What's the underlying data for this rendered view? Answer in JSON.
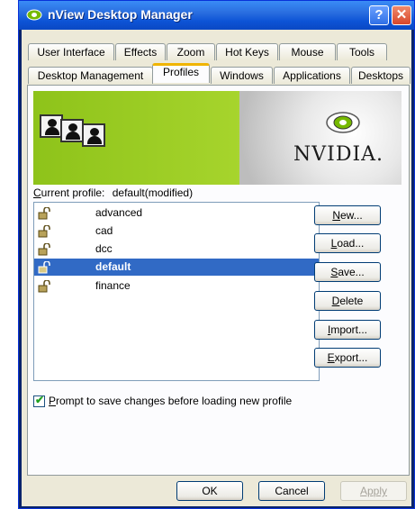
{
  "window": {
    "title": "nView Desktop Manager",
    "help_glyph": "?",
    "close_glyph": "✕"
  },
  "tabs": {
    "row1": [
      "User Interface",
      "Effects",
      "Zoom",
      "Hot Keys",
      "Mouse",
      "Tools"
    ],
    "row2": [
      "Desktop Management",
      "Profiles",
      "Windows",
      "Applications",
      "Desktops"
    ],
    "active": "Profiles"
  },
  "banner": {
    "brand_text": "NVIDIA."
  },
  "current_profile": {
    "label_prefix": "C",
    "label_rest": "urrent profile:",
    "value": "default(modified)"
  },
  "profiles": [
    {
      "name": "advanced",
      "selected": false
    },
    {
      "name": "cad",
      "selected": false
    },
    {
      "name": "dcc",
      "selected": false
    },
    {
      "name": "default",
      "selected": true
    },
    {
      "name": "finance",
      "selected": false
    }
  ],
  "actions": [
    {
      "pre": "",
      "key": "N",
      "post": "ew..."
    },
    {
      "pre": "",
      "key": "L",
      "post": "oad..."
    },
    {
      "pre": "",
      "key": "S",
      "post": "ave..."
    },
    {
      "pre": "",
      "key": "D",
      "post": "elete"
    },
    {
      "pre": "",
      "key": "I",
      "post": "mport..."
    },
    {
      "pre": "",
      "key": "E",
      "post": "xport..."
    }
  ],
  "prompt_checkbox": {
    "checked": true,
    "label_key": "P",
    "label_rest": "rompt to save changes before loading new profile"
  },
  "footer": {
    "ok": "OK",
    "cancel": "Cancel",
    "apply": "Apply"
  },
  "colors": {
    "selection": "#316ac5",
    "banner_green": "#8ec31a"
  }
}
